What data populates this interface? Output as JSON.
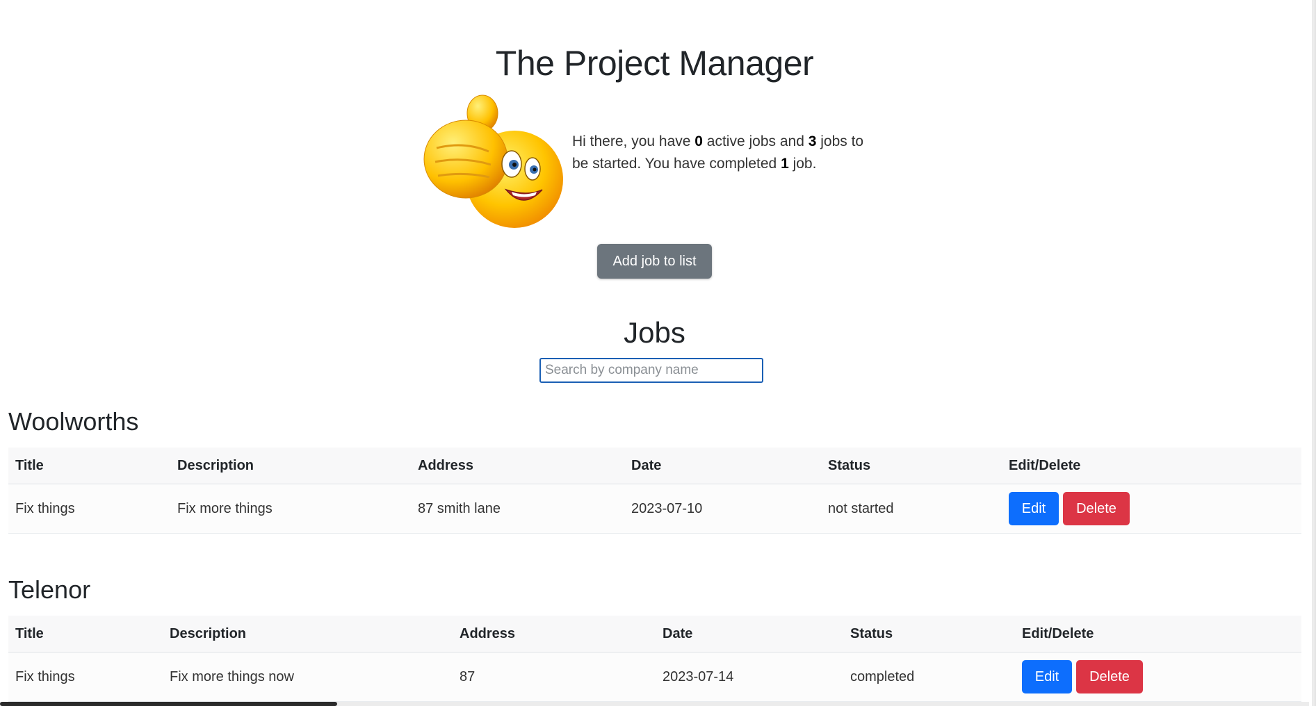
{
  "header": {
    "title": "The Project Manager"
  },
  "welcome": {
    "prefix": "Hi there, you have ",
    "active_count": "0",
    "middle": " active jobs and ",
    "to_start_count": "3",
    "suffix_line": " jobs to be started. You have completed ",
    "completed_count": "1",
    "end": " job."
  },
  "add_button": {
    "label": "Add job to list"
  },
  "jobs": {
    "heading": "Jobs",
    "search_placeholder": "Search by company name"
  },
  "columns": [
    "Title",
    "Description",
    "Address",
    "Date",
    "Status",
    "Edit/Delete"
  ],
  "companies": [
    {
      "name": "Woolworths",
      "rows": [
        {
          "title": "Fix things",
          "description": "Fix more things",
          "address": "87 smith lane",
          "date": "2023-07-10",
          "status": "not started",
          "edit_label": "Edit",
          "delete_label": "Delete"
        }
      ]
    },
    {
      "name": "Telenor",
      "rows": [
        {
          "title": "Fix things",
          "description": "Fix more things now",
          "address": "87",
          "date": "2023-07-14",
          "status": "completed",
          "edit_label": "Edit",
          "delete_label": "Delete"
        }
      ]
    }
  ],
  "colors": {
    "secondary_button": "#6c757d",
    "edit_button": "#0d6efd",
    "delete_button": "#dc3545",
    "search_border": "#1a5fb4"
  },
  "icons": {
    "hero_image": "thumbs-up-smiley-icon"
  }
}
